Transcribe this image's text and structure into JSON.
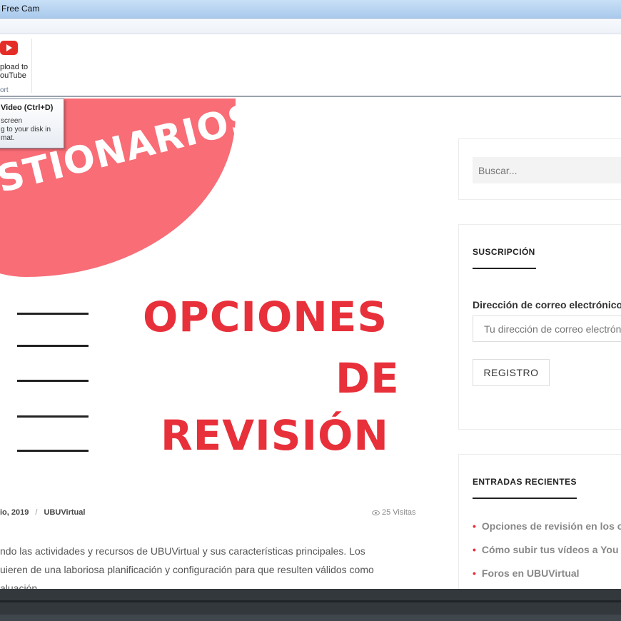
{
  "window": {
    "title": "Free Cam"
  },
  "ribbon": {
    "upload_line1": "pload to",
    "upload_line2": "ouTube",
    "group_label": "ort"
  },
  "tooltip": {
    "title": "Video (Ctrl+D)",
    "line1": "screen",
    "line2": "g to your disk in",
    "line3": "mat."
  },
  "hero": {
    "banner_text": "STIONARIOS",
    "line1": "OPCIONES",
    "line2": "DE",
    "line3": "REVISIÓN"
  },
  "post": {
    "date": "io, 2019",
    "separator": "/",
    "author": "UBUVirtual",
    "views": "25 Visitas",
    "excerpt_line1": "ndo las actividades y recursos de UBUVirtual y sus características principales. Los",
    "excerpt_line2": "uieren de una laboriosa planificación y configuración para que resulten válidos como",
    "excerpt_line3": "aluación."
  },
  "sidebar": {
    "search_placeholder": "Buscar...",
    "subscription": {
      "title": "SUSCRIPCIÓN",
      "email_label": "Dirección de correo electrónico",
      "email_placeholder": "Tu dirección de correo electrónico",
      "button": "REGISTRO"
    },
    "recent": {
      "title": "ENTRADAS RECIENTES",
      "items": [
        "Opciones de revisión en los c",
        "Cómo subir tus vídeos a You",
        "Foros en UBUVirtual"
      ]
    }
  },
  "colors": {
    "accent": "#e8303a",
    "banner": "#f86d76"
  }
}
